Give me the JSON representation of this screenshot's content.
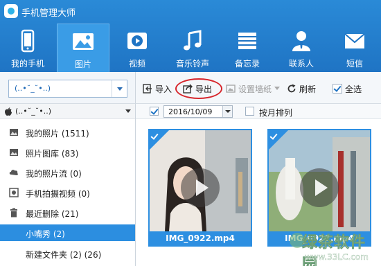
{
  "app": {
    "title": "手机管理大师"
  },
  "nav": {
    "items": [
      {
        "label": "我的手机",
        "icon": "phone-icon"
      },
      {
        "label": "图片",
        "icon": "picture-icon",
        "active": true
      },
      {
        "label": "视频",
        "icon": "video-icon"
      },
      {
        "label": "音乐铃声",
        "icon": "music-icon"
      },
      {
        "label": "备忘录",
        "icon": "memo-icon"
      },
      {
        "label": "联系人",
        "icon": "contacts-icon"
      },
      {
        "label": "短信",
        "icon": "sms-icon"
      }
    ]
  },
  "device_select": {
    "value": "(..•˘_˘•..)"
  },
  "toolbar": {
    "import_label": "导入",
    "export_label": "导出",
    "wallpaper_label": "设置墙纸",
    "refresh_label": "刷新",
    "select_all_label": "全选"
  },
  "sub_toolbar": {
    "date_value": "2016/10/09",
    "date_checked": true,
    "by_month_label": "按月排列",
    "by_month_checked": false
  },
  "sidebar": {
    "device_name": "(..•˘_˘•..)",
    "items": [
      {
        "label": "我的照片 (1511)",
        "icon": "photos-icon"
      },
      {
        "label": "照片图库 (83)",
        "icon": "photo-library-icon"
      },
      {
        "label": "我的照片流 (0)",
        "icon": "photo-stream-icon"
      },
      {
        "label": "手机拍摄视频 (0)",
        "icon": "camera-video-icon"
      },
      {
        "label": "最近删除 (21)",
        "icon": "trash-icon"
      },
      {
        "label": "小嘴秀 (2)",
        "icon": "",
        "selected": true
      },
      {
        "label": "新建文件夹 (2) (26)",
        "icon": ""
      }
    ]
  },
  "thumbnails": [
    {
      "caption": "IMG_0922.mp4",
      "checked": true
    },
    {
      "caption": "IMG_0921.mp4",
      "checked": true
    }
  ],
  "watermark": {
    "text": "绿茶软件园",
    "url": "www.33LC.com"
  },
  "colors": {
    "header": "#1f74c4",
    "accent": "#2d8fe1",
    "highlight": "#d7262c"
  }
}
